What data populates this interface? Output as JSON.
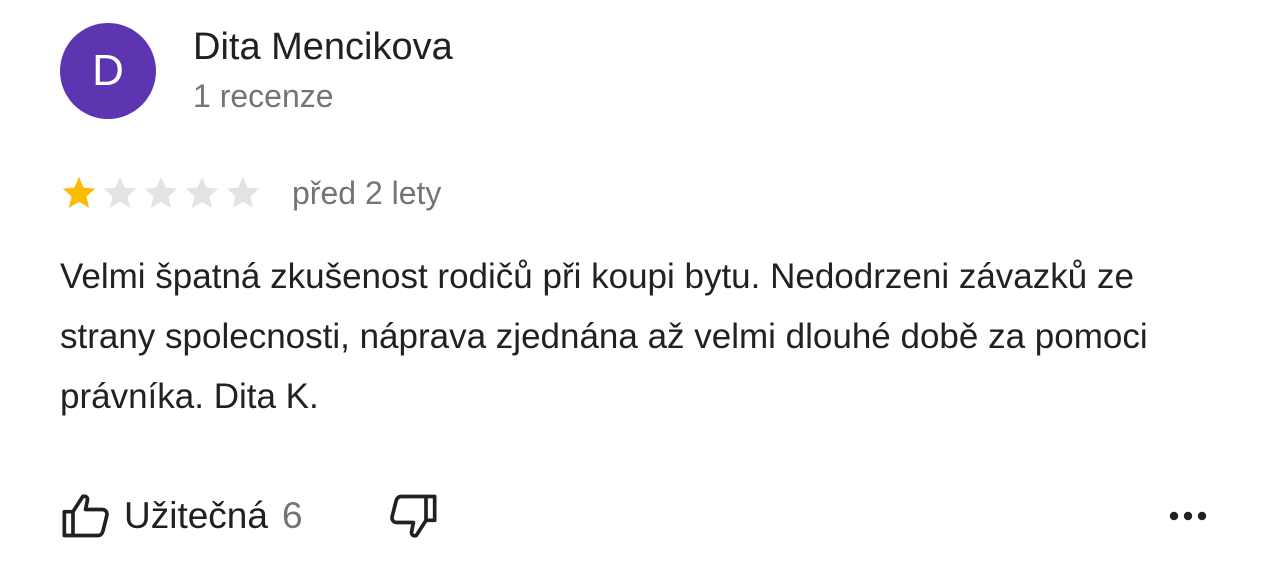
{
  "reviewer": {
    "initial": "D",
    "name": "Dita Mencikova",
    "review_count": "1 recenze",
    "avatar_color": "#5e35b1"
  },
  "review": {
    "rating": 1,
    "max_rating": 5,
    "date": "před 2 lety",
    "text": "Velmi špatná zkušenost rodičů při koupi bytu. Nedodrzeni závazků ze strany spolecnosti, náprava zjednána až velmi dlouhé době za pomoci právníka. Dita K."
  },
  "actions": {
    "helpful_label": "Užitečná",
    "helpful_count": "6",
    "helpful_icon": "thumbs-up-icon",
    "unhelpful_icon": "thumbs-down-icon",
    "more_icon": "more-horizontal-icon"
  },
  "colors": {
    "star_filled": "#fbbc04",
    "star_empty": "#e3e3e3",
    "secondary_text": "#70757a"
  }
}
